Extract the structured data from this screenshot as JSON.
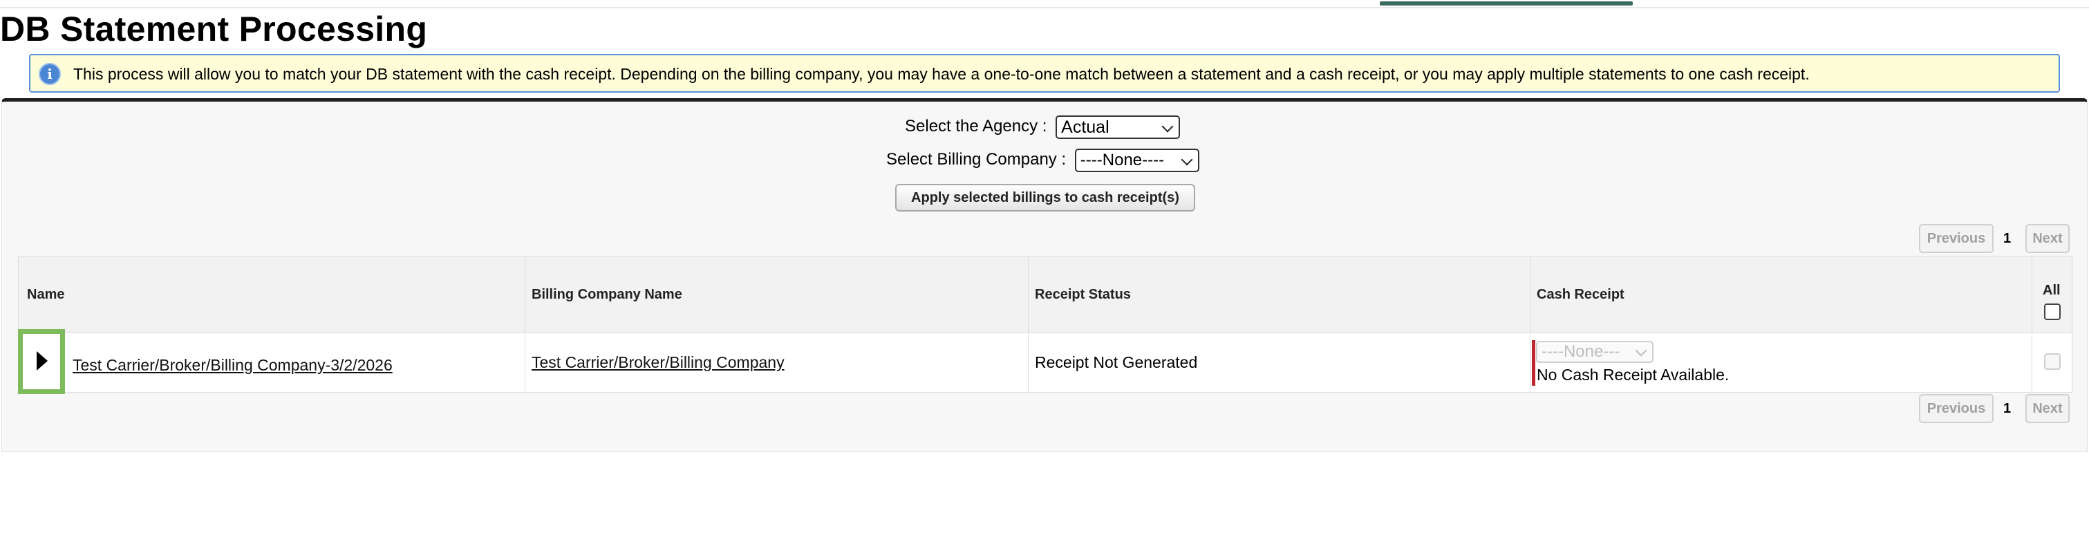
{
  "page": {
    "title": "DB Statement Processing"
  },
  "info": {
    "icon": "info-icon",
    "text": "This process will allow you to match your DB statement with the cash receipt. Depending on the billing company, you may have a one-to-one match between a statement and a cash receipt, or you may apply multiple statements to one cash receipt."
  },
  "filters": {
    "agency_label": "Select the Agency :",
    "agency_value": "Actual",
    "billing_label": "Select Billing Company :",
    "billing_value": "----None----"
  },
  "apply_button": "Apply selected billings to cash receipt(s)",
  "pager": {
    "previous": "Previous",
    "page": "1",
    "next": "Next"
  },
  "table": {
    "headers": {
      "name": "Name",
      "billing_company": "Billing Company Name",
      "receipt_status": "Receipt Status",
      "cash_receipt": "Cash Receipt",
      "all": "All"
    },
    "rows": [
      {
        "name": "Test Carrier/Broker/Billing Company-3/2/2026",
        "billing_company": "Test Carrier/Broker/Billing Company",
        "receipt_status": "Receipt Not Generated",
        "cash_receipt_value": "----None---",
        "cash_receipt_note": "No Cash Receipt Available."
      }
    ]
  },
  "colors": {
    "accent_border": "#5b8fd9",
    "info_background": "#fdfdd8",
    "highlight": "#7dbb5b",
    "error_bar": "#c0282f"
  }
}
